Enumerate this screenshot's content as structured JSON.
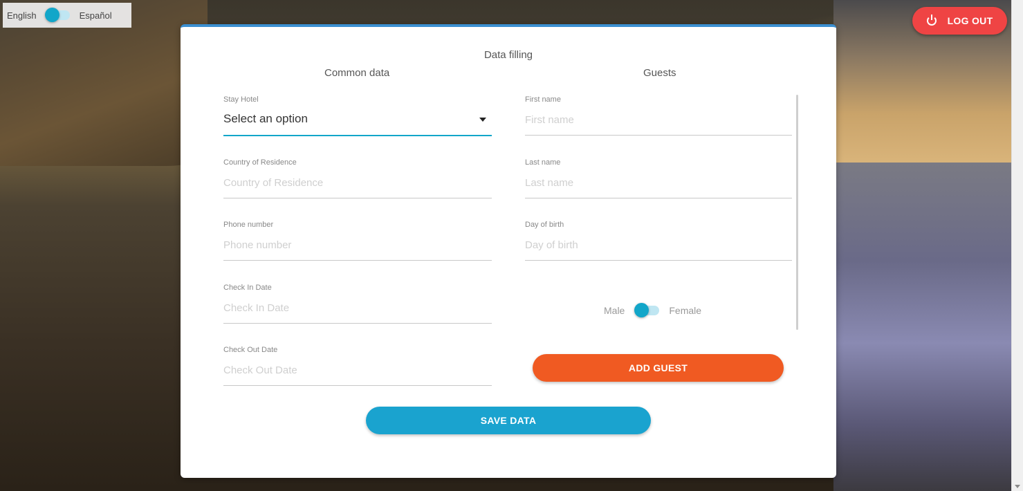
{
  "language": {
    "left_label": "English",
    "right_label": "Español",
    "selected": "English"
  },
  "logout": {
    "label": "LOG OUT",
    "icon": "power-icon",
    "color": "#ef4444"
  },
  "form": {
    "title": "Data filling",
    "common": {
      "title": "Common data",
      "stay_hotel": {
        "label": "Stay Hotel",
        "value": "Select an option"
      },
      "country": {
        "label": "Country of Residence",
        "placeholder": "Country of Residence"
      },
      "phone": {
        "label": "Phone number",
        "placeholder": "Phone number"
      },
      "check_in": {
        "label": "Check In Date",
        "placeholder": "Check In Date"
      },
      "check_out": {
        "label": "Check Out Date",
        "placeholder": "Check Out Date"
      }
    },
    "guests": {
      "title": "Guests",
      "first_name": {
        "label": "First name",
        "placeholder": "First name"
      },
      "last_name": {
        "label": "Last name",
        "placeholder": "Last name"
      },
      "birth": {
        "label": "Day of birth",
        "placeholder": "Day of birth"
      },
      "gender": {
        "left_label": "Male",
        "right_label": "Female",
        "selected": "Male"
      },
      "add_label": "ADD GUEST"
    },
    "save_label": "SAVE DATA"
  },
  "colors": {
    "accent": "#12a6c9",
    "add_button": "#f05a22",
    "save_button": "#1aa3cf"
  }
}
